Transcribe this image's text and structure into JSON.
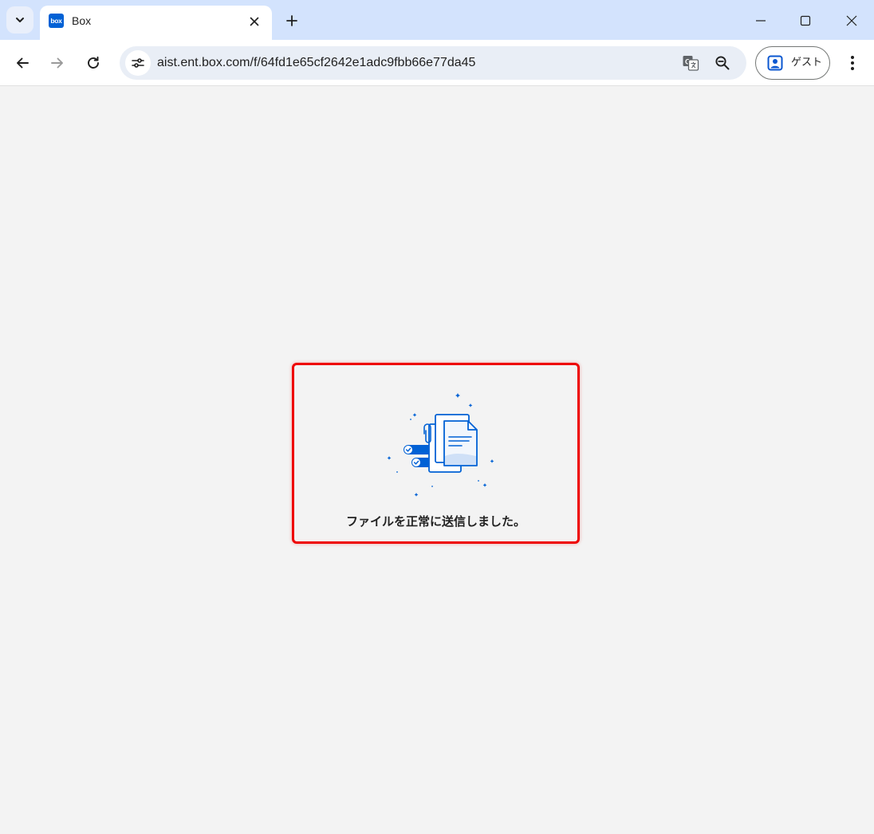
{
  "browser": {
    "tab": {
      "favicon_text": "box",
      "title": "Box"
    },
    "url": "aist.ent.box.com/f/64fd1e65cf2642e1adc9fbb66e77da45",
    "profile_label": "ゲスト"
  },
  "page": {
    "success_message": "ファイルを正常に送信しました。"
  },
  "colors": {
    "box_blue": "#0061d5",
    "highlight_red": "#ee0000",
    "tabstrip": "#d3e3fd",
    "page_bg": "#f3f3f3"
  },
  "icons": [
    "tab-search-chevron-icon",
    "close-icon",
    "plus-icon",
    "minimize-icon",
    "maximize-icon",
    "window-close-icon",
    "back-arrow-icon",
    "forward-arrow-icon",
    "reload-icon",
    "site-info-icon",
    "translate-icon",
    "zoom-out-icon",
    "profile-icon",
    "more-vert-icon",
    "file-upload-success-illustration"
  ]
}
